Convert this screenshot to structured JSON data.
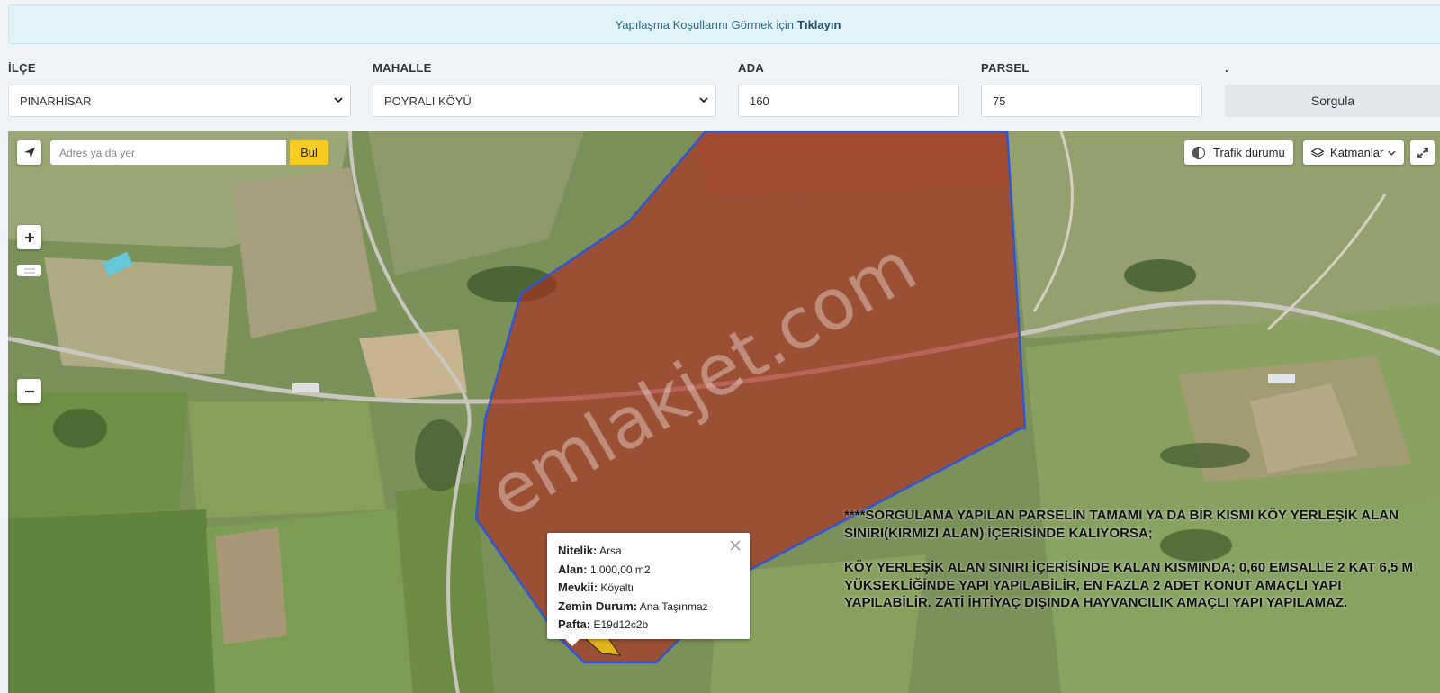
{
  "banner": {
    "text": "Yapılaşma Koşullarını Görmek için",
    "link": "Tıklayın"
  },
  "form": {
    "ilce_label": "İLÇE",
    "mahalle_label": "MAHALLE",
    "ada_label": "ADA",
    "parsel_label": "PARSEL",
    "dot_label": ".",
    "ilce_value": "PINARHİSAR",
    "mahalle_value": "POYRALI KÖYÜ",
    "ada_value": "160",
    "parsel_value": "75",
    "sorgula_label": "Sorgula"
  },
  "map": {
    "search_placeholder": "Adres ya da yer",
    "bul_label": "Bul",
    "traffic_label": "Trafik durumu",
    "layers_label": "Katmanlar",
    "watermark": "emlakjet.com",
    "colors": {
      "zone_fill": "#b0281f",
      "zone_stroke": "#2f55d4",
      "parcel": "#e0b41c"
    },
    "popup": {
      "nitelik_key": "Nitelik:",
      "nitelik_val": "Arsa",
      "alan_key": "Alan:",
      "alan_val": "1.000,00 m2",
      "mevkii_key": "Mevkii:",
      "mevkii_val": "Köyaltı",
      "zemin_key": "Zemin Durum:",
      "zemin_val": "Ana Taşınmaz",
      "pafta_key": "Pafta:",
      "pafta_val": "E19d12c2b"
    },
    "note": {
      "line1": "****SORGULAMA YAPILAN PARSELİN TAMAMI YA DA BİR KISMI KÖY YERLEŞİK ALAN SINIRI(KIRMIZI ALAN) İÇERİSİNDE KALIYORSA;",
      "line2": "KÖY YERLEŞİK ALAN SINIRI İÇERİSİNDE KALAN KISMINDA; 0,60 EMSALLE 2 KAT 6,5 M YÜKSEKLİĞİNDE YAPI YAPILABİLİR, EN FAZLA 2 ADET KONUT AMAÇLI YAPI YAPILABİLİR. ZATİ İHTİYAÇ DIŞINDA HAYVANCILIK AMAÇLI YAPI YAPILAMAZ."
    }
  }
}
